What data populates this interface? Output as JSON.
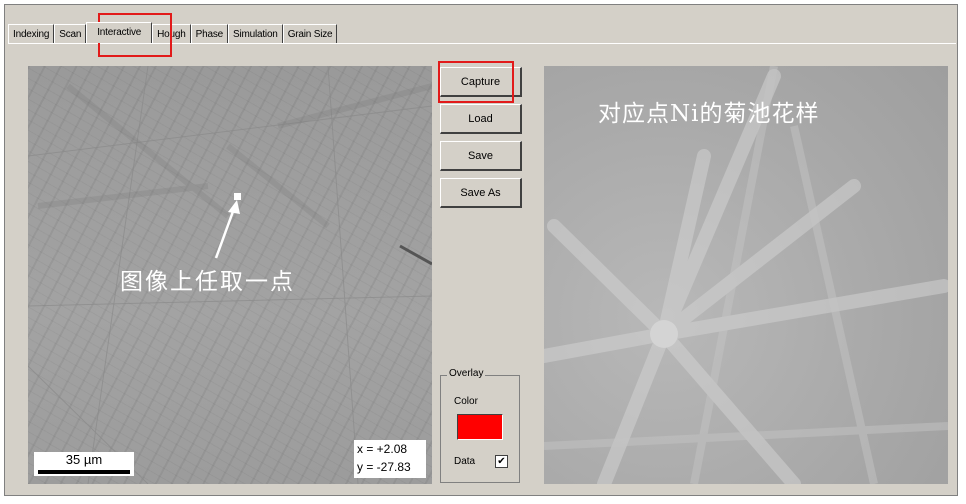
{
  "tabs": [
    {
      "label": "Indexing"
    },
    {
      "label": "Scan"
    },
    {
      "label": "Interactive"
    },
    {
      "label": "Hough"
    },
    {
      "label": "Phase"
    },
    {
      "label": "Simulation"
    },
    {
      "label": "Grain Size"
    }
  ],
  "active_tab": "Interactive",
  "sem_image": {
    "annotation": "图像上任取一点",
    "scale_bar": "35 µm",
    "coord_x": "x = +2.08",
    "coord_y": "y = -27.83"
  },
  "buttons": {
    "capture": "Capture",
    "load": "Load",
    "save": "Save",
    "save_as": "Save As"
  },
  "overlay": {
    "title": "Overlay",
    "color_label": "Color",
    "color_value": "#ff0000",
    "data_label": "Data",
    "data_checked": true,
    "check_mark": "✔"
  },
  "pattern_image": {
    "title": "对应点Ni的菊池花样"
  },
  "highlight_color": "#e21a1a"
}
